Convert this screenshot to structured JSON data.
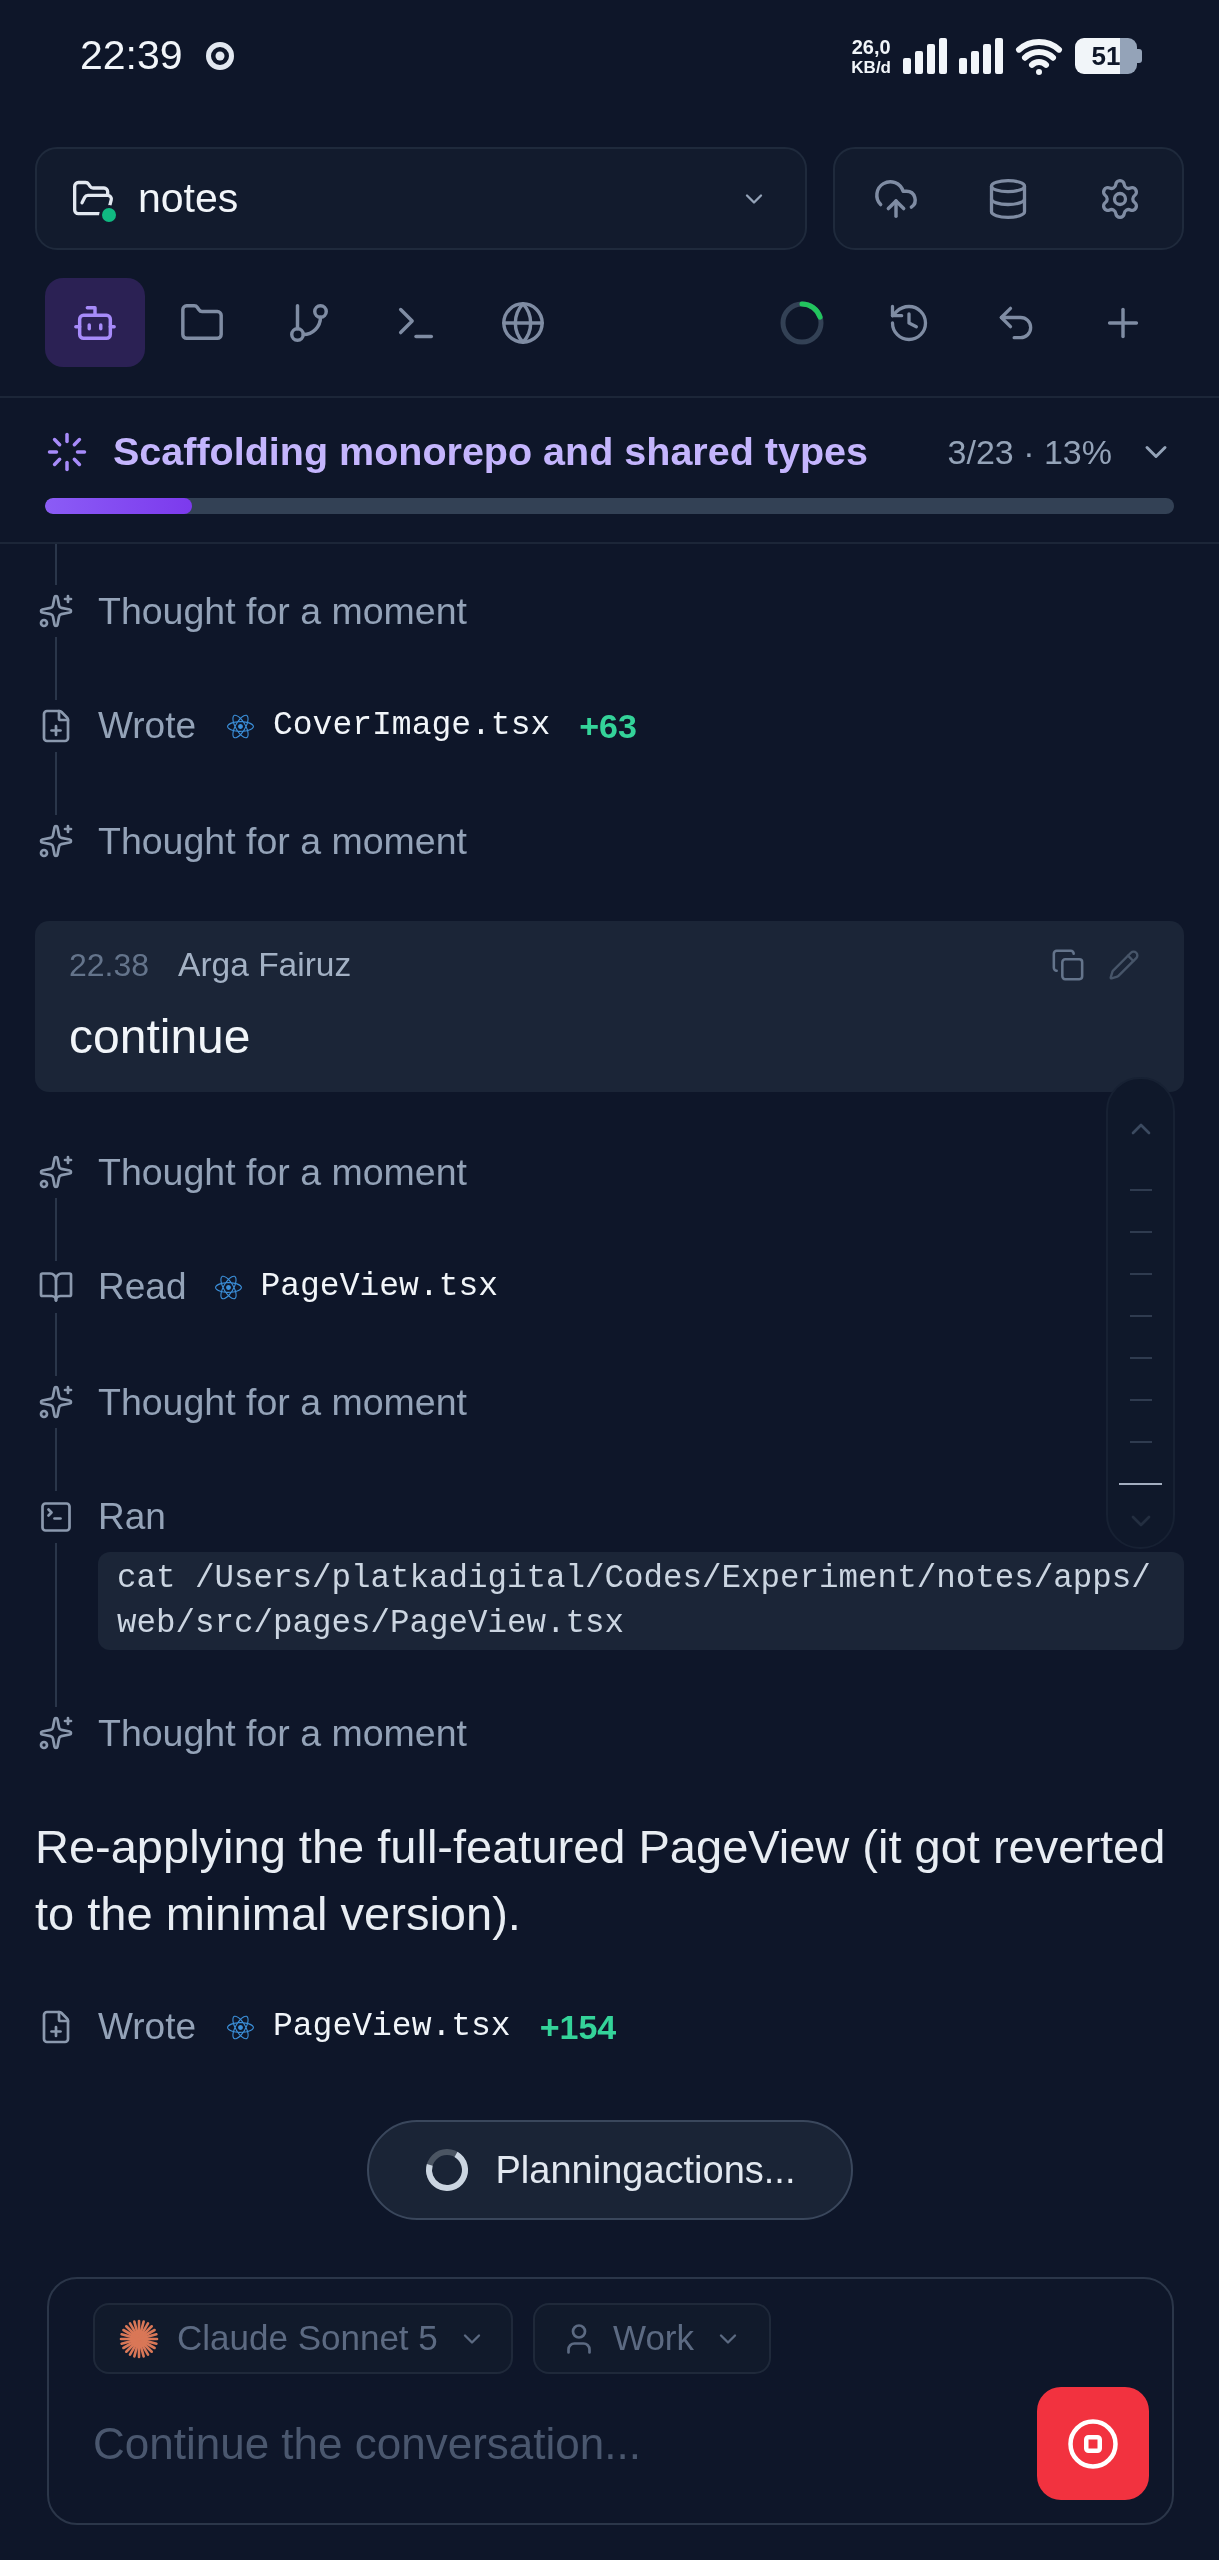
{
  "status_bar": {
    "time": "22:39",
    "network_speed": "26,0",
    "network_unit": "KB/d",
    "battery": "51"
  },
  "project": {
    "name": "notes",
    "connected": true
  },
  "tabs": [
    {
      "selected": true
    },
    {
      "selected": false
    },
    {
      "selected": false
    },
    {
      "selected": false
    },
    {
      "selected": false
    }
  ],
  "task": {
    "title": "Scaffolding monorepo and shared types",
    "progress": "3/23 · 13%",
    "level": 0.13
  },
  "timeline": [
    {
      "kind": "steps",
      "continued": true,
      "steps": [
        {
          "kind": "thought",
          "label": "Thought for a moment"
        },
        {
          "kind": "write",
          "verb": "Wrote",
          "file": "CoverImage.tsx",
          "added": "+63"
        },
        {
          "kind": "thought",
          "label": "Thought for a moment"
        }
      ]
    },
    {
      "kind": "user_message",
      "time": "22.38",
      "author": "Arga Fairuz",
      "text": "continue"
    },
    {
      "kind": "steps",
      "steps": [
        {
          "kind": "thought",
          "label": "Thought for a moment"
        },
        {
          "kind": "read",
          "verb": "Read",
          "file": "PageView.tsx"
        },
        {
          "kind": "thought",
          "label": "Thought for a moment"
        },
        {
          "kind": "command",
          "verb": "Ran",
          "command": "cat /Users/platkadigital/Codes/Experiment/notes/apps/web/src/pages/PageView.tsx"
        },
        {
          "kind": "thought",
          "label": "Thought for a moment"
        }
      ]
    },
    {
      "kind": "text",
      "text": "Re-applying the full-featured PageView (it got reverted to the minimal version)."
    },
    {
      "kind": "steps",
      "steps": [
        {
          "kind": "write",
          "verb": "Wrote",
          "file": "PageView.tsx",
          "added": "+154"
        }
      ]
    }
  ],
  "message_navigator": {
    "markers": [
      {
        "selected": false
      },
      {
        "selected": false
      },
      {
        "selected": false
      },
      {
        "selected": false
      },
      {
        "selected": false
      },
      {
        "selected": false
      },
      {
        "selected": false
      },
      {
        "selected": true
      }
    ]
  },
  "status_pill": {
    "label": "Planningactions..."
  },
  "composer": {
    "model": "Claude Sonnet 5",
    "profile": "Work",
    "placeholder": "Continue the conversation..."
  }
}
